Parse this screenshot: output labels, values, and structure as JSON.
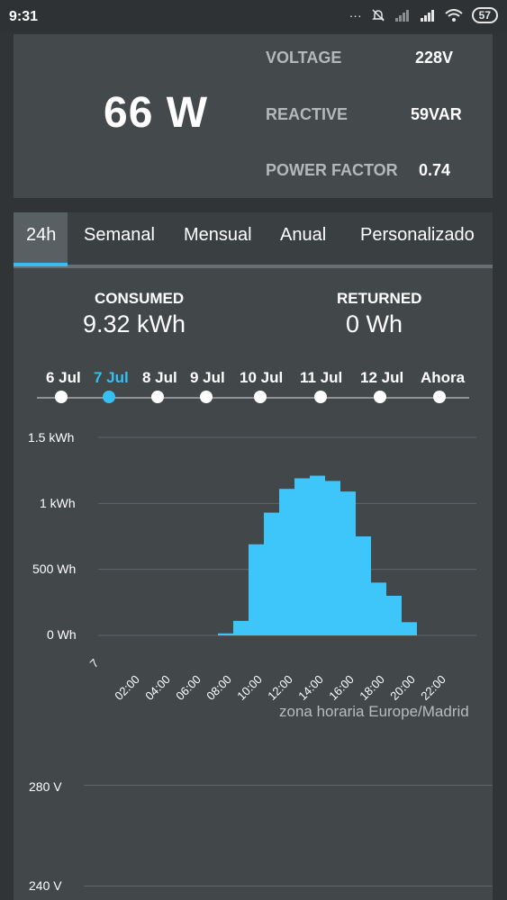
{
  "status_bar": {
    "time": "9:31",
    "battery": "57",
    "icons": [
      "ellipsis-icon",
      "bell-off-icon",
      "signal-weak-icon",
      "signal-icon",
      "wifi-icon",
      "battery-icon"
    ]
  },
  "power_card": {
    "value": "66 W",
    "voltage_label": "VOLTAGE",
    "voltage_value": "228V",
    "reactive_label": "REACTIVE",
    "reactive_value": "59VAR",
    "pf_label": "POWER FACTOR",
    "pf_value": "0.74"
  },
  "tabs": [
    "24h",
    "Semanal",
    "Mensual",
    "Anual",
    "Personalizado"
  ],
  "active_tab": "24h",
  "summary": {
    "consumed_label": "CONSUMED",
    "consumed_value": "9.32 kWh",
    "returned_label": "RETURNED",
    "returned_value": "0 Wh"
  },
  "timeline": {
    "days": [
      "6 Jul",
      "7 Jul",
      "8 Jul",
      "9 Jul",
      "10 Jul",
      "11 Jul",
      "12 Jul",
      "Ahora"
    ],
    "selected": "7 Jul"
  },
  "colors": {
    "accent": "#36c0f2",
    "bar": "#3ec6fb",
    "background": "#303436",
    "card": "#44494b"
  },
  "chart_data": {
    "type": "bar",
    "x_tick_labels": [
      "7",
      "02:00",
      "04:00",
      "06:00",
      "08:00",
      "10:00",
      "12:00",
      "14:00",
      "16:00",
      "18:00",
      "20:00",
      "22:00"
    ],
    "y_tick_labels": [
      "1.5 kWh",
      "1 kWh",
      "500 Wh",
      "0 Wh"
    ],
    "y_ticks": [
      1500,
      1000,
      500,
      0
    ],
    "ylim": [
      0,
      1500
    ],
    "hours": [
      7,
      8,
      9,
      10,
      11,
      12,
      13,
      14,
      15,
      16,
      17,
      18,
      19,
      20
    ],
    "values": [
      15,
      110,
      690,
      930,
      1110,
      1190,
      1210,
      1170,
      1090,
      750,
      400,
      300,
      100,
      0
    ],
    "unit": "Wh",
    "timezone_note": "zona horaria Europe/Madrid"
  },
  "voltage_chart": {
    "y_tick_labels": [
      "280 V",
      "240 V"
    ]
  }
}
